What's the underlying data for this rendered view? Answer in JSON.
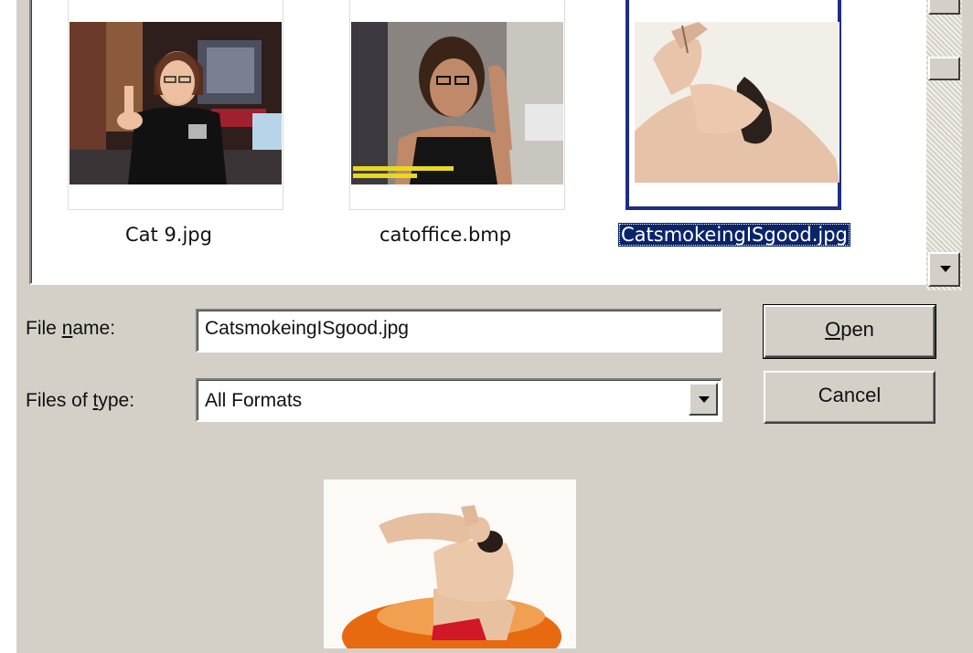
{
  "files": [
    {
      "name": "Cat 9.jpg",
      "selected": false
    },
    {
      "name": "catoffice.bmp",
      "selected": false
    },
    {
      "name": "CatsmokeingISgood.jpg",
      "selected": true
    }
  ],
  "form": {
    "file_name_label_prefix": "File ",
    "file_name_label_accel": "n",
    "file_name_label_suffix": "ame:",
    "file_name_value": "CatsmokeingISgood.jpg",
    "file_type_label_prefix": "Files of ",
    "file_type_label_accel": "t",
    "file_type_label_suffix": "ype:",
    "file_type_value": "All Formats"
  },
  "buttons": {
    "open_accel": "O",
    "open_rest": "pen",
    "cancel": "Cancel"
  },
  "colors": {
    "dialog_bg": "#d4d0c8",
    "selection": "#0a246a",
    "selected_frame": "#1f2d84"
  },
  "icons": [
    "scroll-down-arrow-icon",
    "dropdown-arrow-icon"
  ]
}
